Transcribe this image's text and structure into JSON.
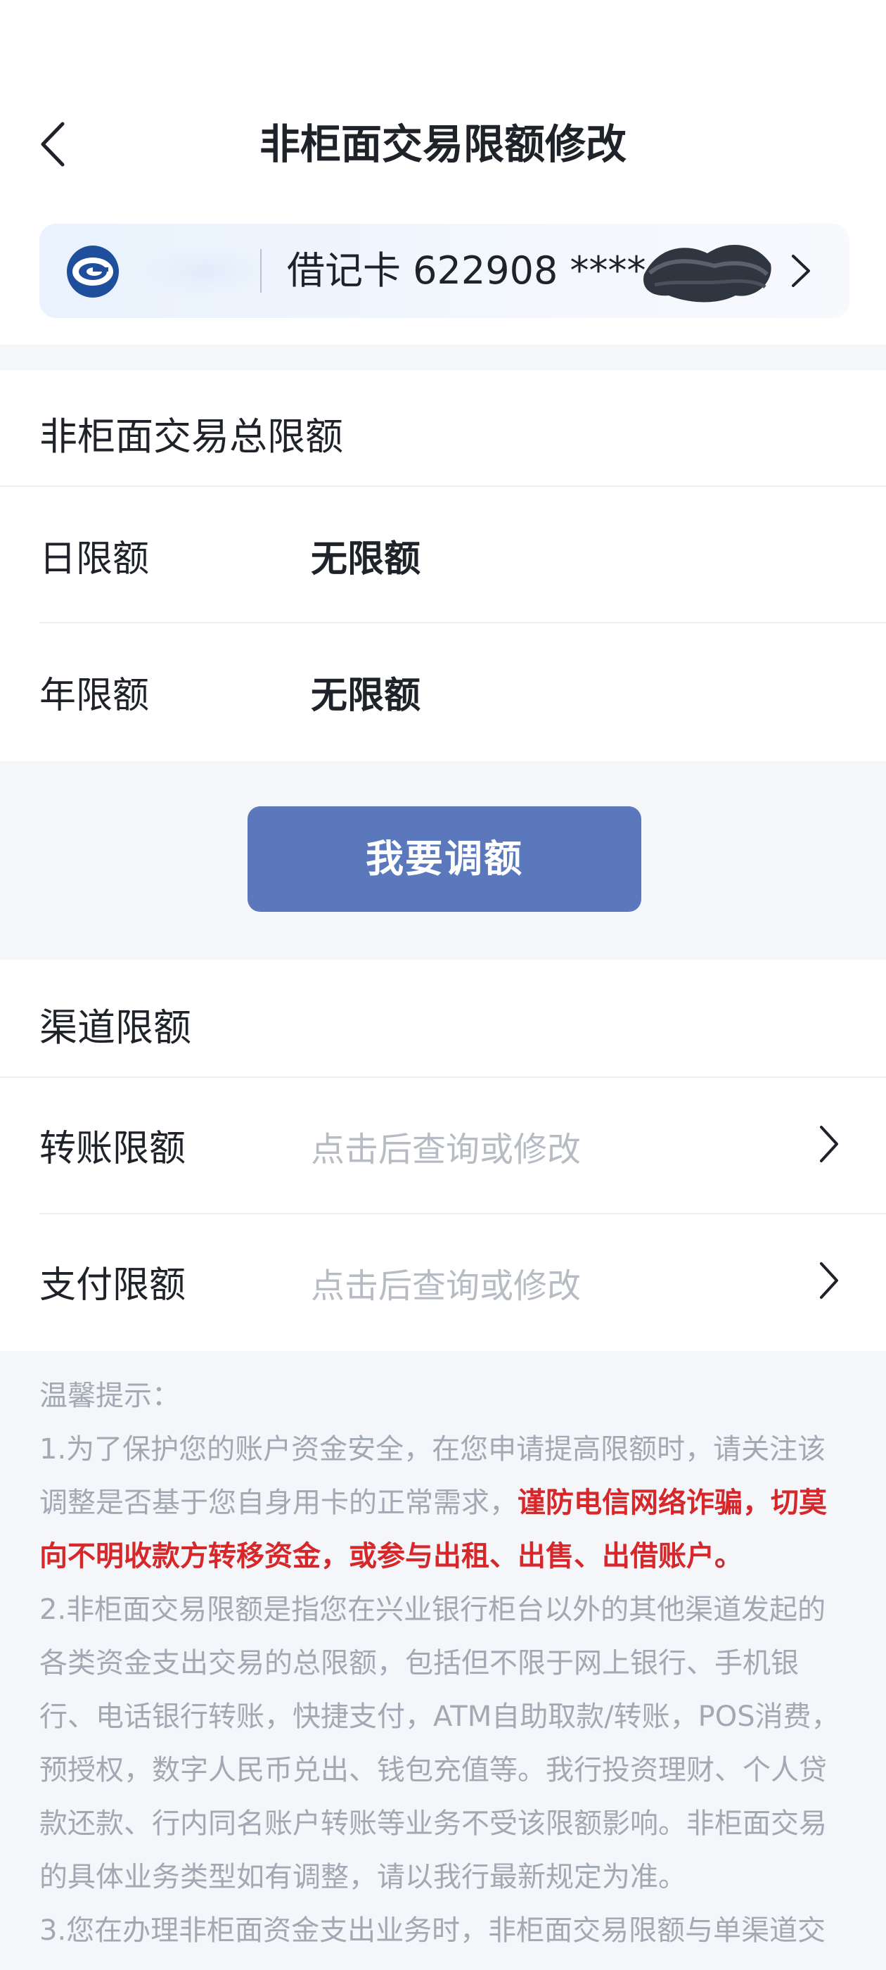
{
  "header": {
    "title": "非柜面交易限额修改"
  },
  "card": {
    "text": "借记卡 622908 ****"
  },
  "total_limit": {
    "title": "非柜面交易总限额",
    "rows": [
      {
        "label": "日限额",
        "value": "无限额"
      },
      {
        "label": "年限额",
        "value": "无限额"
      }
    ],
    "adjust_button": "我要调额"
  },
  "channel_limit": {
    "title": "渠道限额",
    "rows": [
      {
        "label": "转账限额",
        "placeholder": "点击后查询或修改"
      },
      {
        "label": "支付限额",
        "placeholder": "点击后查询或修改"
      }
    ]
  },
  "notice": {
    "title": "温馨提示：",
    "p1_a": "1.为了保护您的账户资金安全，在您申请提高限额时，请关注该调整是否基于您自身用卡的正常需求，",
    "p1_warn": "谨防电信网络诈骗，切莫向不明收款方转移资金，或参与出租、出售、出借账户。",
    "p2": "2.非柜面交易限额是指您在兴业银行柜台以外的其他渠道发起的各类资金支出交易的总限额，包括但不限于网上银行、手机银行、电话银行转账，快捷支付，ATM自助取款/转账，POS消费，预授权，数字人民币兑出、钱包充值等。我行投资理财、个人贷款还款、行内同名账户转账等业务不受该限额影响。非柜面交易的具体业务类型如有调整，请以我行最新规定为准。",
    "p3": "3.您在办理非柜面资金支出业务时，非柜面交易限额与单渠道交"
  },
  "colors": {
    "accent": "#5b78bd",
    "warning": "#d6272b",
    "logo": "#1f4f9c"
  }
}
